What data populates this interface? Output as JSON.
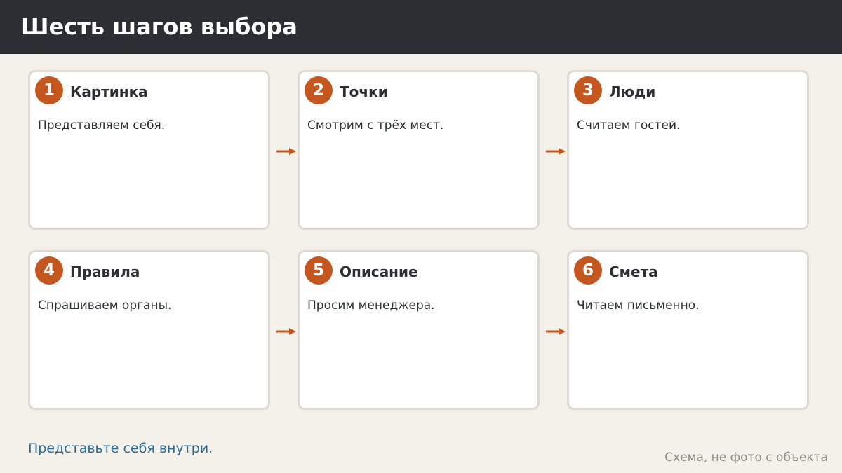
{
  "header": {
    "title": "Шесть шагов выбора"
  },
  "steps": [
    {
      "number": "1",
      "title": "Картинка",
      "description": "Представляем себя."
    },
    {
      "number": "2",
      "title": "Точки",
      "description": "Смотрим с трёх мест."
    },
    {
      "number": "3",
      "title": "Люди",
      "description": "Считаем гостей."
    },
    {
      "number": "4",
      "title": "Правила",
      "description": "Спрашиваем органы."
    },
    {
      "number": "5",
      "title": "Описание",
      "description": "Просим менеджера."
    },
    {
      "number": "6",
      "title": "Смета",
      "description": "Читаем письменно."
    }
  ],
  "footer": {
    "note": "Представьте себя внутри.",
    "caption": "Схема, не фото с объекта"
  },
  "colors": {
    "header_bg": "#2b2e33",
    "accent": "#c4561f",
    "page_bg": "#f4f1ea",
    "link": "#2e6a94"
  }
}
